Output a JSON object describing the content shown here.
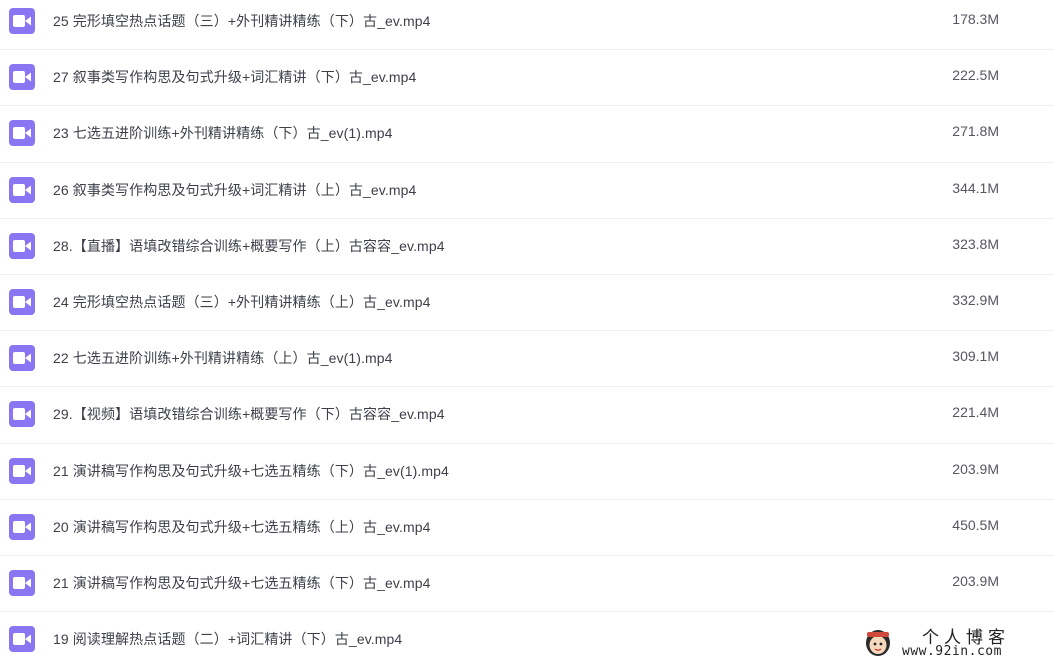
{
  "files": [
    {
      "name": "25 完形填空热点话题（三）+外刊精讲精练（下）古_ev.mp4",
      "size": "178.3M",
      "icon": "video-icon"
    },
    {
      "name": "27 叙事类写作构思及句式升级+词汇精讲（下）古_ev.mp4",
      "size": "222.5M",
      "icon": "video-icon"
    },
    {
      "name": "23 七选五进阶训练+外刊精讲精练（下）古_ev(1).mp4",
      "size": "271.8M",
      "icon": "video-icon"
    },
    {
      "name": "26 叙事类写作构思及句式升级+词汇精讲（上）古_ev.mp4",
      "size": "344.1M",
      "icon": "video-icon"
    },
    {
      "name": "28.【直播】语填改错综合训练+概要写作（上）古容容_ev.mp4",
      "size": "323.8M",
      "icon": "video-icon"
    },
    {
      "name": "24 完形填空热点话题（三）+外刊精讲精练（上）古_ev.mp4",
      "size": "332.9M",
      "icon": "video-icon"
    },
    {
      "name": "22 七选五进阶训练+外刊精讲精练（上）古_ev(1).mp4",
      "size": "309.1M",
      "icon": "video-icon"
    },
    {
      "name": "29.【视频】语填改错综合训练+概要写作（下）古容容_ev.mp4",
      "size": "221.4M",
      "icon": "video-icon"
    },
    {
      "name": "21 演讲稿写作构思及句式升级+七选五精练（下）古_ev(1).mp4",
      "size": "203.9M",
      "icon": "video-icon"
    },
    {
      "name": "20 演讲稿写作构思及句式升级+七选五精练（上）古_ev.mp4",
      "size": "450.5M",
      "icon": "video-icon"
    },
    {
      "name": "21 演讲稿写作构思及句式升级+七选五精练（下）古_ev.mp4",
      "size": "203.9M",
      "icon": "video-icon"
    },
    {
      "name": "19 阅读理解热点话题（二）+词汇精讲（下）古_ev.mp4",
      "size": "",
      "icon": "video-icon"
    }
  ],
  "watermark": {
    "title": "个人博客",
    "url": "www.92in.com"
  },
  "colors": {
    "icon_bg": "#8a76f2",
    "text": "#3d3f4a",
    "divider": "#ededf2"
  }
}
